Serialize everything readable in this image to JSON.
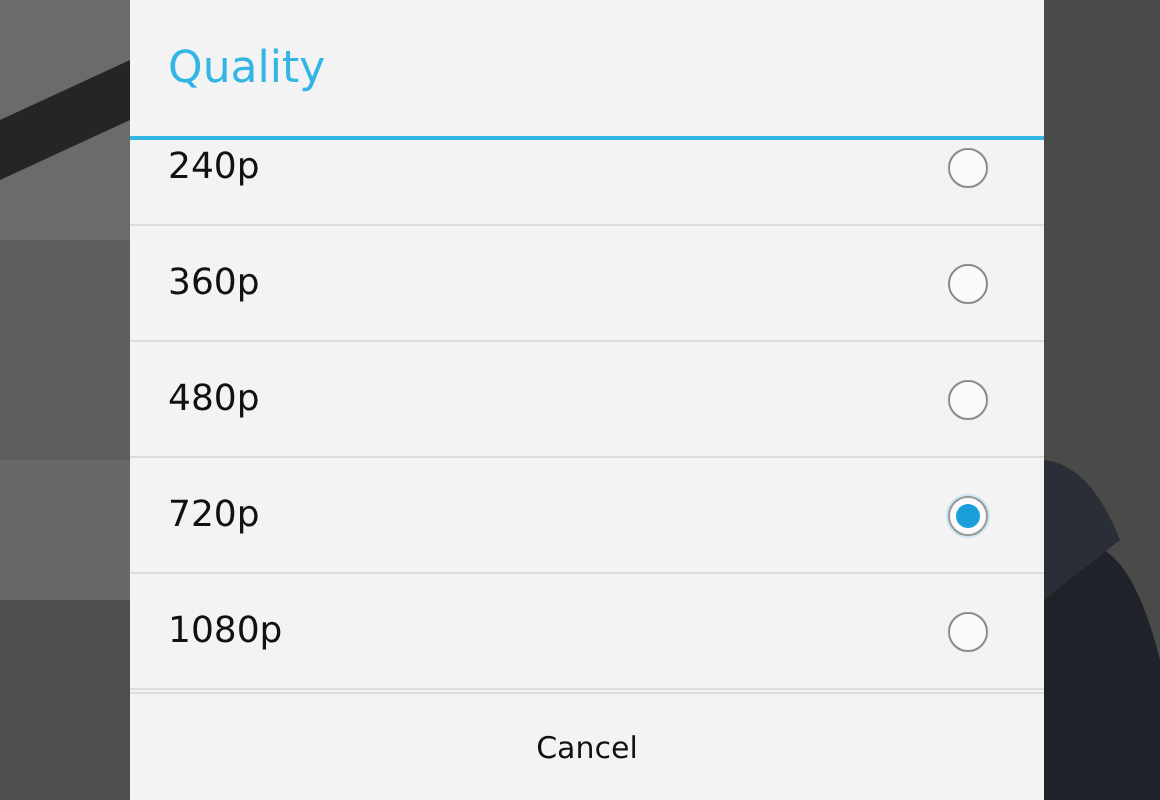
{
  "dialog": {
    "title": "Quality",
    "options": [
      {
        "label": "240p",
        "selected": false
      },
      {
        "label": "360p",
        "selected": false
      },
      {
        "label": "480p",
        "selected": false
      },
      {
        "label": "720p",
        "selected": true
      },
      {
        "label": "1080p",
        "selected": false
      }
    ],
    "buttons": [
      "Cancel"
    ]
  }
}
